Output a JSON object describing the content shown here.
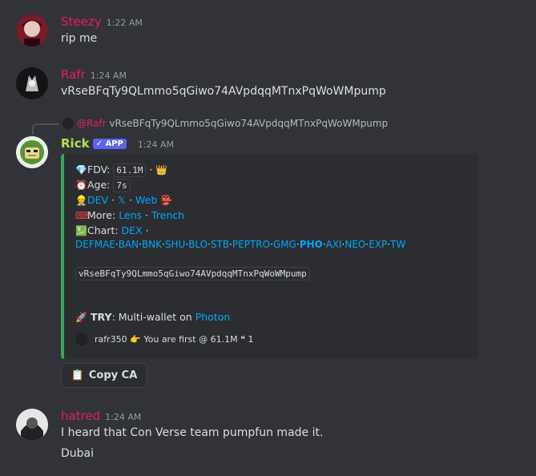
{
  "messages": [
    {
      "user": "Steezy",
      "time": "1:22 AM",
      "text": "rip me",
      "color": "#e0225a"
    },
    {
      "user": "Rafr",
      "time": "1:24 AM",
      "text": "vRseBFqTy9QLmmo5qGiwo74AVpdqqMTnxPqWoWMpump",
      "color": "#e0225a"
    },
    {
      "user": "hatred",
      "time": "1:24 AM",
      "text": "I heard that Con Verse team pumpfun made it.",
      "text2": "Dubai",
      "color": "#e0225a"
    }
  ],
  "reply": {
    "mention": "@Rafr",
    "text": "vRseBFqTy9QLmmo5qGiwo74AVpdqqMTnxPqWoWMpump"
  },
  "bot": {
    "user": "Rick",
    "badge": "APP",
    "time": "1:24 AM",
    "color": "#b6e34a"
  },
  "embed": {
    "fdv_label": "FDV:",
    "fdv_value": "61.1M",
    "age_label": "Age:",
    "age_value": "7s",
    "dev_link": "DEV",
    "x_link": "𝕏",
    "web_link": "Web",
    "more_label": "More:",
    "lens_link": "Lens",
    "trench_link": "Trench",
    "chart_label": "Chart:",
    "dex_link": "DEX",
    "chart_links": [
      "DEFMAE",
      "BAN",
      "BNK",
      "SHU",
      "BLO",
      "STB",
      "PEPTRO",
      "GMG",
      "PHO",
      "AXI",
      "NEO",
      "EXP",
      "TW"
    ],
    "ca": "vRseBFqTy9QLmmo5qGiwo74AVpdqqMTnxPqWoWMpump",
    "try_label": "TRY",
    "try_text": ": Multi-wallet on",
    "photon_link": "Photon",
    "footer_user": "rafr350",
    "footer_text": "You are first @ 61.1M",
    "footer_count": "1"
  },
  "copy_button": {
    "label": "Copy CA"
  },
  "colors": {
    "background": "#313338",
    "embed_bar": "#3ba55c",
    "link": "#00a8fc"
  }
}
